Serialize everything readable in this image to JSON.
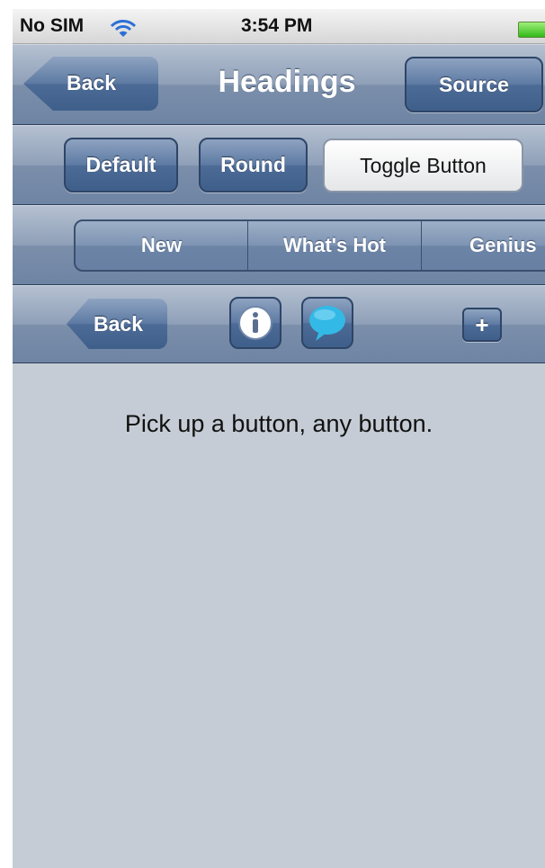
{
  "status_bar": {
    "carrier": "No SIM",
    "time": "3:54 PM",
    "wifi_icon": "wifi-icon",
    "battery_icon": "battery-icon",
    "battery_color": "#31b818"
  },
  "nav_bar": {
    "back_label": "Back",
    "title": "Headings",
    "source_label": "Source"
  },
  "button_bar": {
    "default_label": "Default",
    "round_label": "Round",
    "toggle_label": "Toggle Button"
  },
  "segmented": {
    "items": [
      {
        "label": "New"
      },
      {
        "label": "What's Hot"
      },
      {
        "label": "Genius"
      }
    ]
  },
  "icon_bar": {
    "back_label": "Back",
    "info_icon": "info-icon",
    "chat_icon": "chat-bubble-icon",
    "add_label": "+"
  },
  "content": {
    "message": "Pick up a button, any button."
  },
  "colors": {
    "toolbar": "#6e84a3",
    "button": "#4c6b96",
    "background": "#c5ccd5"
  }
}
